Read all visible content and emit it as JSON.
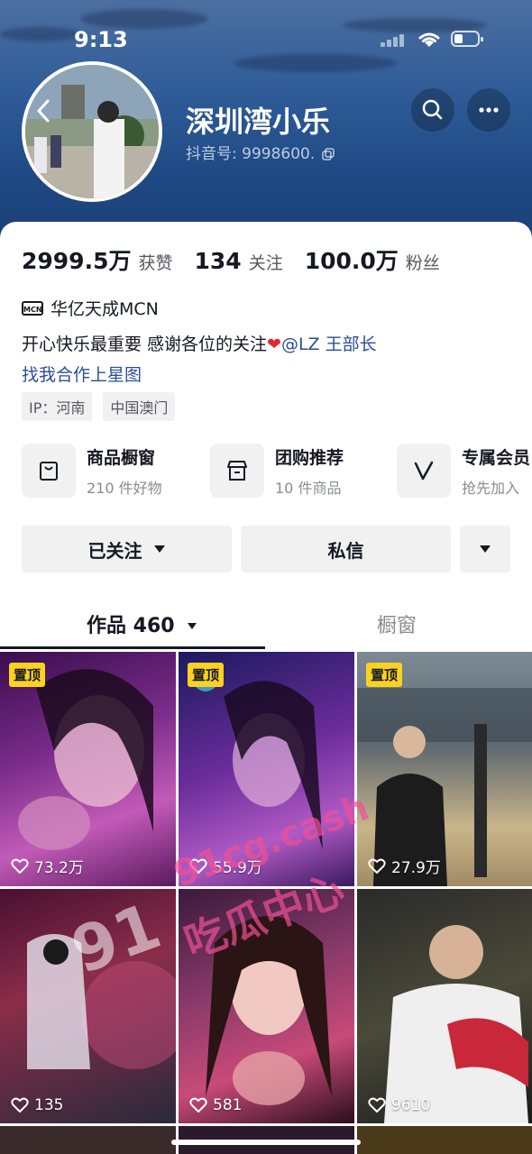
{
  "status": {
    "time": "9:13"
  },
  "profile": {
    "name": "深圳湾小乐",
    "douyin_id": "抖音号: 9998600.",
    "stats": [
      {
        "num": "2999.5万",
        "label": "获赞"
      },
      {
        "num": "134",
        "label": "关注"
      },
      {
        "num": "100.0万",
        "label": "粉丝"
      }
    ],
    "mcn_badge": "MCN",
    "mcn": "华亿天成MCN",
    "bio_text": "开心快乐最重要 感谢各位的关注",
    "bio_mention": "@LZ 王部长",
    "collab_link": "找我合作上星图",
    "tags": [
      "IP：河南",
      "中国澳门"
    ]
  },
  "services": [
    {
      "title": "商品橱窗",
      "sub": "210 件好物",
      "icon": "bag-icon"
    },
    {
      "title": "团购推荐",
      "sub": "10 件商品",
      "icon": "store-icon"
    },
    {
      "title": "专属会员",
      "sub": "抢先加入",
      "icon": "v-icon"
    }
  ],
  "actions": {
    "follow": "已关注",
    "message": "私信"
  },
  "tabs": {
    "works": "作品 460",
    "window": "橱窗"
  },
  "videos": [
    {
      "pin": "置顶",
      "likes": "73.2万"
    },
    {
      "pin": "置顶",
      "likes": "55.9万"
    },
    {
      "pin": "置顶",
      "likes": "27.9万"
    },
    {
      "pin": "",
      "likes": "135"
    },
    {
      "pin": "",
      "likes": "581"
    },
    {
      "pin": "",
      "likes": "9610"
    }
  ],
  "watermark": {
    "line1": "91cg.cash",
    "line2": "吃瓜中心",
    "big": "91"
  },
  "colors": {
    "accent_link": "#2b4d9b",
    "pin_badge": "#fbd21e",
    "header": "#2f5c98"
  }
}
